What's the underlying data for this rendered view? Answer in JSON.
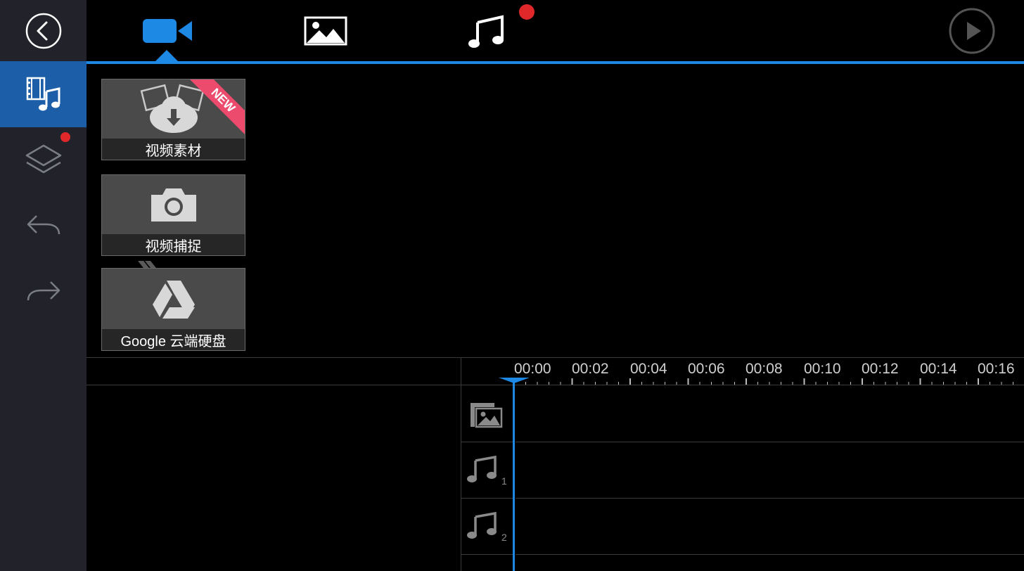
{
  "sidebar": {
    "back_icon": "back-circle-icon",
    "items": [
      {
        "name": "media-library",
        "icon": "film-music-icon",
        "active": true
      },
      {
        "name": "layers",
        "icon": "layers-icon",
        "badge": true
      },
      {
        "name": "undo",
        "icon": "undo-arrow-icon"
      },
      {
        "name": "redo",
        "icon": "redo-arrow-icon"
      }
    ]
  },
  "toolbar": {
    "tabs": [
      {
        "name": "video",
        "icon": "video-camera-icon",
        "active": true
      },
      {
        "name": "photo",
        "icon": "image-icon"
      },
      {
        "name": "music",
        "icon": "music-note-icon",
        "badge": true
      }
    ],
    "play_icon": "play-icon"
  },
  "tiles": [
    {
      "label": "视频素材",
      "icon": "cloud-download-icon",
      "ribbon": "NEW"
    },
    {
      "label": "视频捕捉",
      "icon": "camera-icon"
    },
    {
      "label": "Google 云端硬盘",
      "icon": "google-drive-icon"
    }
  ],
  "timeline": {
    "ruler": [
      "00:00",
      "00:02",
      "00:04",
      "00:06",
      "00:08",
      "00:10",
      "00:12",
      "00:14",
      "00:16"
    ],
    "tracks": [
      {
        "name": "video-track",
        "icon": "video-photo-track-icon",
        "number": ""
      },
      {
        "name": "audio-track-1",
        "icon": "music-note-icon",
        "number": "1"
      },
      {
        "name": "audio-track-2",
        "icon": "music-note-icon",
        "number": "2"
      }
    ]
  },
  "colors": {
    "accent": "#1e88e5",
    "sidebar_bg": "#22232a",
    "sidebar_active": "#1c5ea8",
    "badge": "#e0282b",
    "ribbon": "#ec4b6d"
  }
}
